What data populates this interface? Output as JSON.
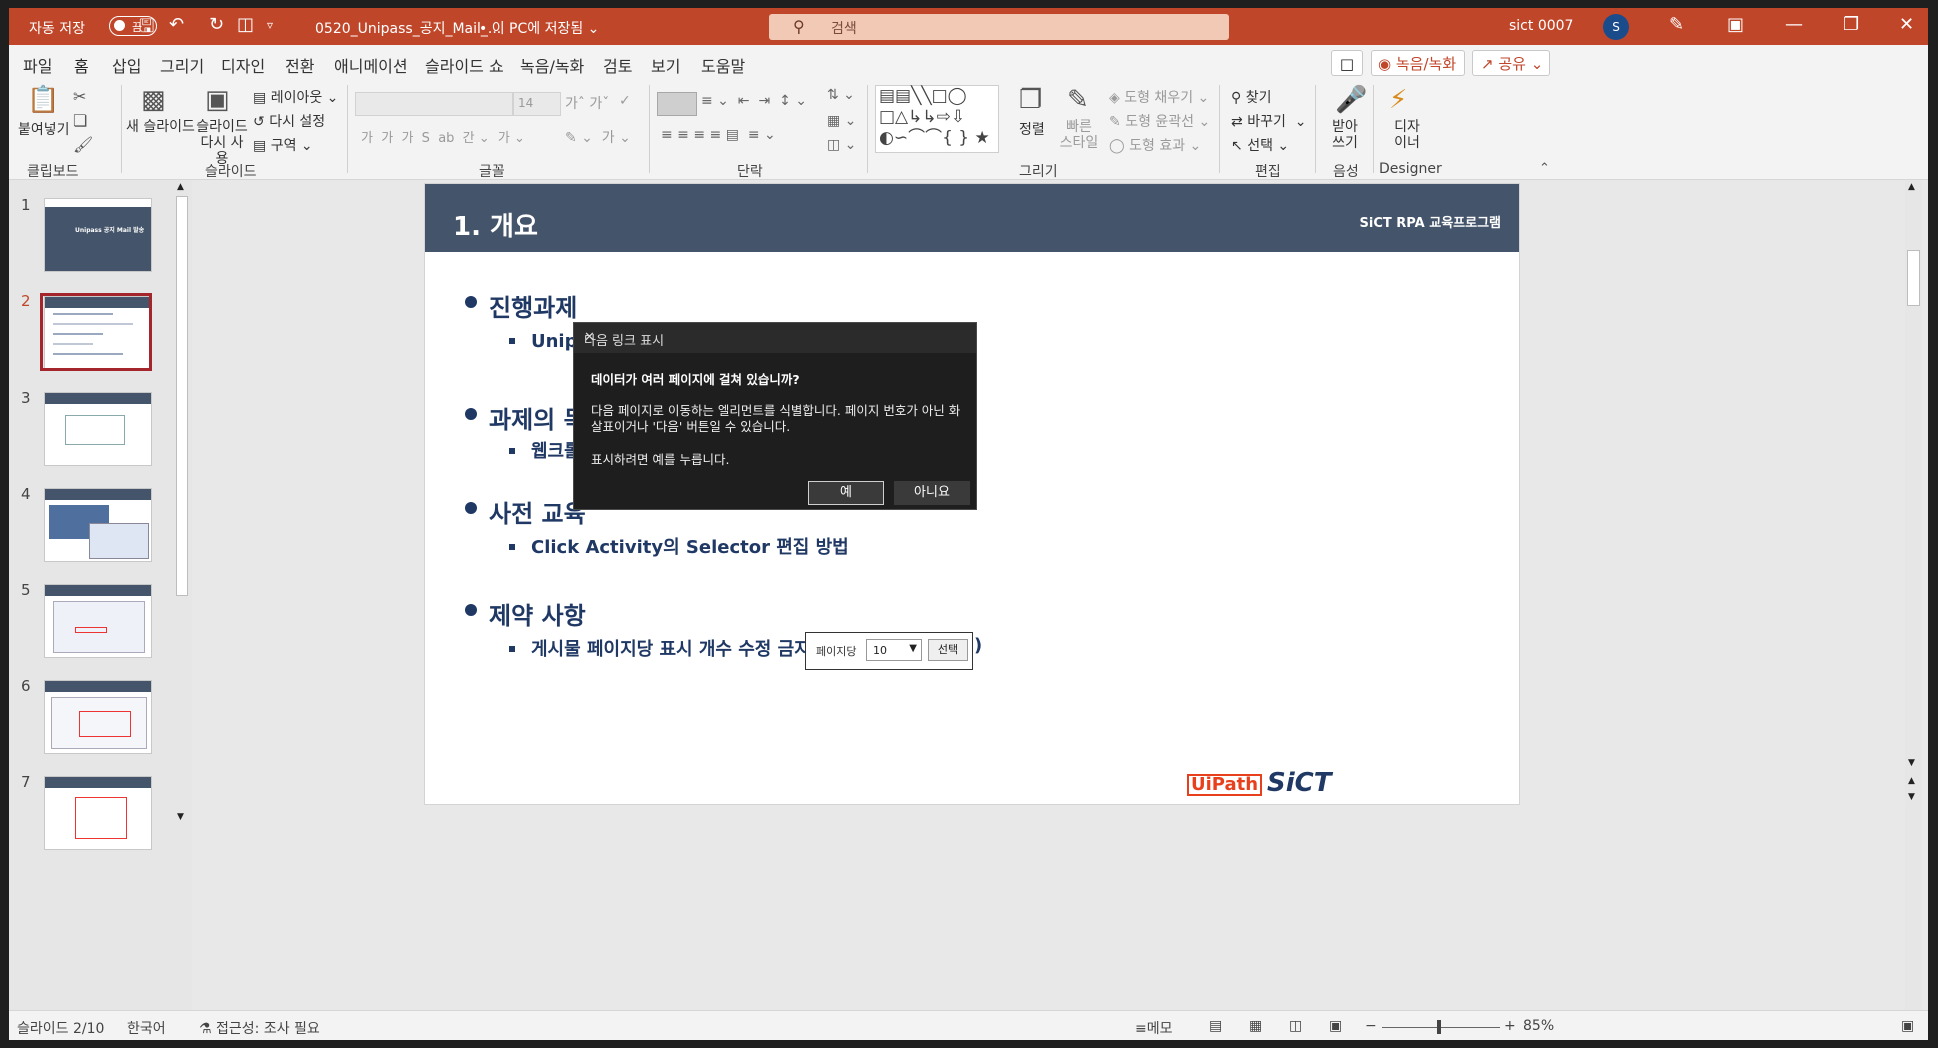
{
  "titlebar": {
    "autosave_label": "자동 저장",
    "autosave_state": "끔",
    "doc_title": "0520_Unipass_공지_Mail_...",
    "save_location": "• 이 PC에 저장됨 ⌄",
    "search_placeholder": "검색",
    "user_name": "sict 0007",
    "avatar_initial": "S"
  },
  "menu": {
    "tabs": [
      "파일",
      "홈",
      "삽입",
      "그리기",
      "디자인",
      "전환",
      "애니메이션",
      "슬라이드 쇼",
      "녹음/녹화",
      "검토",
      "보기",
      "도움말"
    ],
    "active_tab": "홈",
    "record_button": "녹음/녹화",
    "share_button": "공유"
  },
  "ribbon": {
    "clipboard": {
      "paste": "붙여넣기",
      "group": "클립보드"
    },
    "slides": {
      "new_slide": "새 슬라이드",
      "reuse_slide": "슬라이드 다시 사용",
      "layout": "레이아웃",
      "reset": "다시 설정",
      "section": "구역",
      "group": "슬라이드"
    },
    "font": {
      "size": "14",
      "group": "글꼴"
    },
    "paragraph": {
      "group": "단락"
    },
    "drawing": {
      "arrange": "정렬",
      "quick_styles": "빠른 스타일",
      "fill": "도형 채우기",
      "outline": "도형 윤곽선",
      "effects": "도형 효과",
      "group": "그리기"
    },
    "editing": {
      "find": "찾기",
      "replace": "바꾸기",
      "select": "선택",
      "group": "편집"
    },
    "voice": {
      "dictate": "받아 쓰기",
      "group": "음성"
    },
    "designer": {
      "label": "디자 이너",
      "group": "Designer"
    }
  },
  "thumbnails": {
    "numbers": [
      "1",
      "2",
      "3",
      "4",
      "5",
      "6",
      "7"
    ],
    "selected": "2",
    "slide1_title": "Unipass 공지 Mail 발송"
  },
  "slide": {
    "title": "1. 개요",
    "program": "SiCT RPA 교육프로그램",
    "sections": [
      {
        "heading": "진행과제",
        "item": "Unipass 공지사항 Mail 발송"
      },
      {
        "heading": "과제의 목적",
        "item": "웹크롤링"
      },
      {
        "heading": "사전 교육",
        "item": "Click Activity의 Selector 편집 방법"
      },
      {
        "heading": "제약 사항",
        "item": "게시물 페이지당 표시 개수 수정 금지(",
        "item_end": ")"
      }
    ],
    "inline_label": "페이지당",
    "inline_select": "10",
    "inline_button": "선택",
    "logo_uipath": "UiPath",
    "logo_sict": "SiCT"
  },
  "dialog": {
    "title": "다음 링크 표시",
    "question": "데이터가 여러 페이지에 걸쳐 있습니까?",
    "desc": "다음 페이지로 이동하는 엘리먼트를 식별합니다. 페이지 번호가 아닌 화살표이거나 '다음' 버튼일 수 있습니다.",
    "instruction": "표시하려면 예를 누릅니다.",
    "yes": "예",
    "no": "아니요"
  },
  "statusbar": {
    "slide_count": "슬라이드 2/10",
    "language": "한국어",
    "accessibility": "접근성: 조사 필요",
    "notes": "메모",
    "zoom": "85%"
  }
}
